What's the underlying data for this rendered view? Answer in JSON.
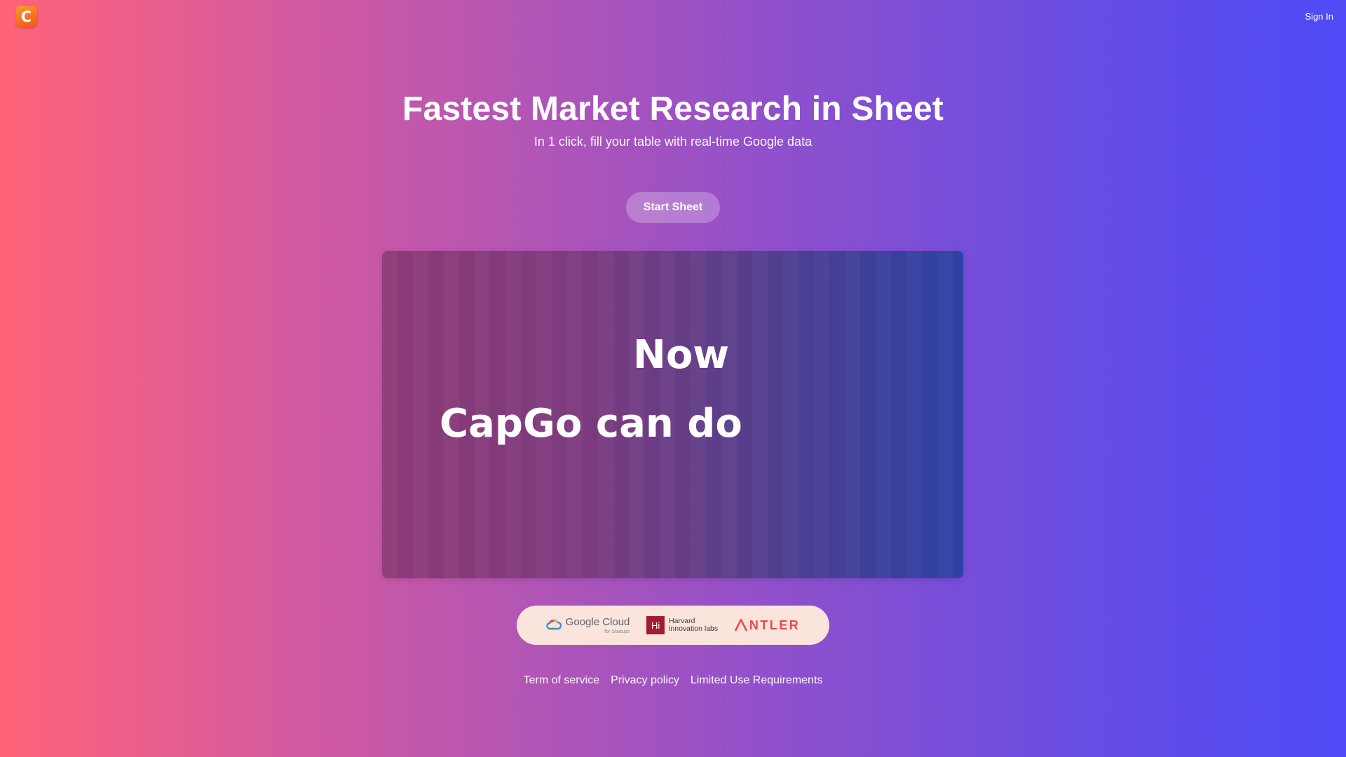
{
  "header": {
    "logo_letter": "C",
    "sign_in_label": "Sign In"
  },
  "hero": {
    "title": "Fastest Market Research in Sheet",
    "subtitle": "In 1 click, fill your table with real-time Google data",
    "cta_label": "Start Sheet"
  },
  "video": {
    "line1": "Now",
    "line2": "CapGo can do"
  },
  "partners": {
    "google_cloud": {
      "name": "Google Cloud",
      "sub": "for Startups"
    },
    "harvard": {
      "badge": "Hi",
      "line1": "Harvard",
      "line2": "innovation labs"
    },
    "antler": {
      "name": "NTLER"
    }
  },
  "footer": {
    "links": [
      "Term of service",
      "Privacy policy",
      "Limited Use Requirements"
    ]
  },
  "colors": {
    "gradient_left": "#ff6378",
    "gradient_right": "#4e4bf7",
    "logo_orange": "#f2521f",
    "partners_bg": "#fbe4dc",
    "harvard_red": "#a51c30",
    "antler_red": "#e64b48"
  },
  "icons": {
    "logo": "capgo-logo-icon",
    "google_cloud": "google-cloud-icon",
    "antler": "antler-logo-icon"
  }
}
